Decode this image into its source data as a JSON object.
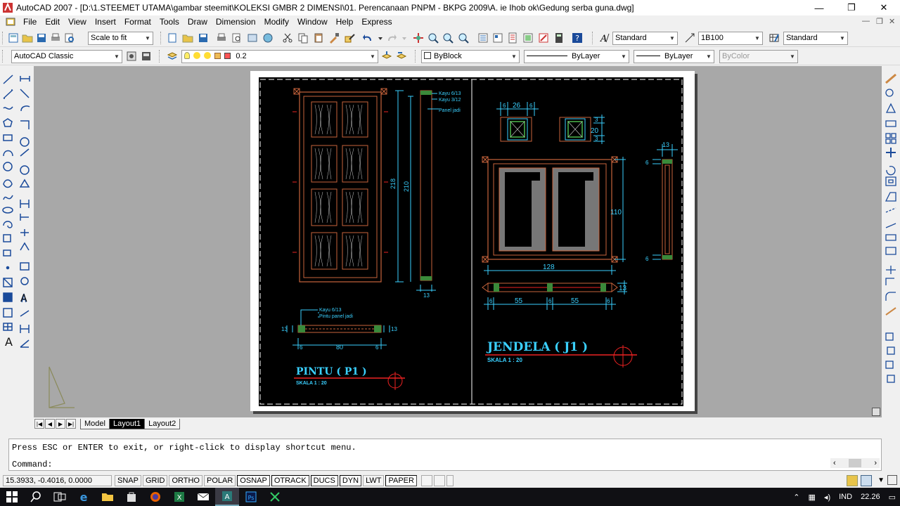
{
  "window": {
    "title": "AutoCAD 2007 - [D:\\1.STEEMET UTAMA\\gambar steemit\\KOLEKSI GMBR 2 DIMENSI\\01. Perencanaan PNPM - BKPG 2009\\A. ie Ihob ok\\Gedung serba guna.dwg]",
    "minimize": "—",
    "restore": "❐",
    "close": "✕"
  },
  "menu": [
    "File",
    "Edit",
    "View",
    "Insert",
    "Format",
    "Tools",
    "Draw",
    "Dimension",
    "Modify",
    "Window",
    "Help",
    "Express"
  ],
  "toolbar": {
    "zoom_scale": "Scale to fit",
    "text_style": "Standard",
    "dim_style": "1B100",
    "table_style": "Standard",
    "workspace": "AutoCAD Classic",
    "layer": "0.2",
    "color": "ByBlock",
    "linetype": "ByLayer",
    "lineweight": "ByLayer",
    "plotstyle": "ByColor"
  },
  "drawing": {
    "door_title": "PINTU ( P1 )",
    "door_scale": "SKALA  1 : 20",
    "window_title": "JENDELA ( J1 )",
    "window_scale": "SKALA  1 : 20",
    "door_notes": [
      "Kayu 6/13",
      "Kayu 3/12",
      "Panel jadi"
    ],
    "door_section_notes": [
      "Kayu 6/13",
      "Pintu panel jadi"
    ],
    "door_dims": {
      "h_outer": "218",
      "h_inner": "210",
      "side_w": "13",
      "sec_w": "80",
      "sec_t1": "13",
      "sec_t2": "13",
      "sec_6a": "6",
      "sec_6b": "6"
    },
    "window_dims": {
      "w_26": "26",
      "w_6a": "6",
      "w_6b": "6",
      "h_20": "20",
      "h_3a": "3",
      "h_3b": "3",
      "height": "110",
      "width": "128",
      "side_13": "13",
      "side_6a": "6",
      "side_6b": "6",
      "sec_13": "13",
      "sec_55a": "55",
      "sec_55b": "55",
      "sec_6a": "6",
      "sec_6b": "6",
      "sec_6c": "6"
    }
  },
  "tabs": [
    "Model",
    "Layout1",
    "Layout2"
  ],
  "active_tab": "Layout1",
  "command": {
    "history": "Press ESC or ENTER to exit, or right-click to display shortcut menu.",
    "prompt": "Command:"
  },
  "status": {
    "coords": "15.3933, -0.4016, 0.0000",
    "toggles": [
      "SNAP",
      "GRID",
      "ORTHO",
      "POLAR",
      "OSNAP",
      "OTRACK",
      "DUCS",
      "DYN",
      "LWT",
      "PAPER"
    ]
  },
  "tray": {
    "lang": "IND",
    "time": "22.26"
  }
}
